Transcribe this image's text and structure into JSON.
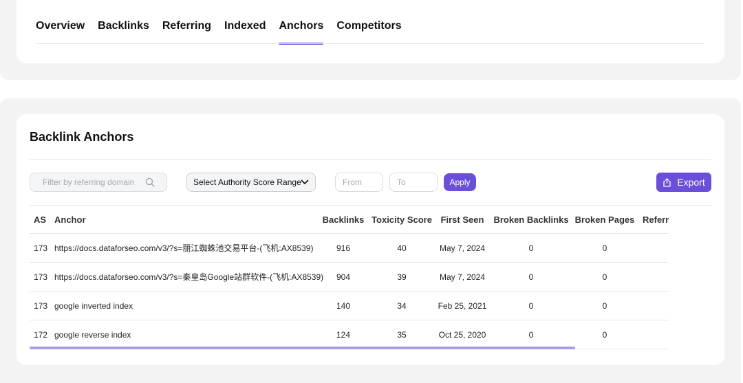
{
  "tabs": [
    {
      "label": "Overview",
      "active": false
    },
    {
      "label": "Backlinks",
      "active": false
    },
    {
      "label": "Referring",
      "active": false
    },
    {
      "label": "Indexed",
      "active": false
    },
    {
      "label": "Anchors",
      "active": true
    },
    {
      "label": "Competitors",
      "active": false
    }
  ],
  "section": {
    "title": "Backlink Anchors"
  },
  "filters": {
    "domain_placeholder": "Filter by referring domain",
    "authority_select": "Select Authority Score Range",
    "from_placeholder": "From",
    "to_placeholder": "To",
    "apply_label": "Apply",
    "export_label": "Export"
  },
  "table": {
    "headers": {
      "as": "AS",
      "anchor": "Anchor",
      "backlinks": "Backlinks",
      "toxicity": "Toxicity Score",
      "first_seen": "First Seen",
      "broken_backlinks": "Broken Backlinks",
      "broken_pages": "Broken Pages",
      "referring": "Referr"
    },
    "rows": [
      {
        "as": "173",
        "anchor": "https://docs.dataforseo.com/v3/?s=丽江蜘蛛池交易平台-(飞机:AX8539)",
        "backlinks": "916",
        "toxicity": "40",
        "first_seen": "May 7, 2024",
        "broken_backlinks": "0",
        "broken_pages": "0"
      },
      {
        "as": "173",
        "anchor": "https://docs.dataforseo.com/v3/?s=秦皇岛Google站群软件-(飞机:AX8539)",
        "backlinks": "904",
        "toxicity": "39",
        "first_seen": "May 7, 2024",
        "broken_backlinks": "0",
        "broken_pages": "0"
      },
      {
        "as": "173",
        "anchor": "google inverted index",
        "backlinks": "140",
        "toxicity": "34",
        "first_seen": "Feb 25, 2021",
        "broken_backlinks": "0",
        "broken_pages": "0"
      },
      {
        "as": "172",
        "anchor": "google reverse index",
        "backlinks": "124",
        "toxicity": "35",
        "first_seen": "Oct 25, 2020",
        "broken_backlinks": "0",
        "broken_pages": "0"
      }
    ]
  },
  "colors": {
    "accent": "#6b4fd8",
    "scrollbar": "#a99be6"
  },
  "icons": {
    "search": "search-icon",
    "dropdown": "chevron-down-icon",
    "export": "export-icon"
  }
}
